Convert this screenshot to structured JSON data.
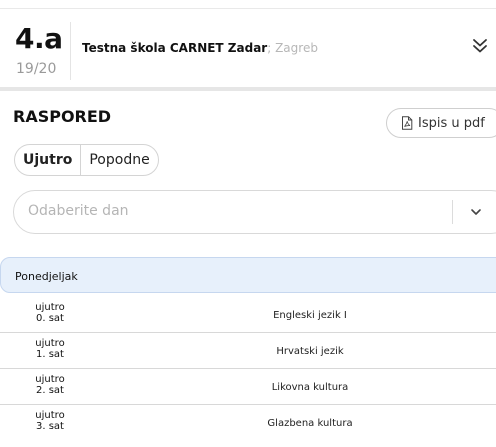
{
  "class": {
    "name": "4.a",
    "school_year": "19/20",
    "school_name": "Testna škola CARNET Zadar",
    "school_sep": ";",
    "city": "Zagreb"
  },
  "schedule": {
    "title": "RASPORED",
    "pdf_button": "Ispis u pdf",
    "shift_tabs": [
      {
        "label": "Ujutro",
        "active": true
      },
      {
        "label": "Popodne",
        "active": false
      }
    ],
    "day_select_placeholder": "Odaberite dan",
    "day": "Ponedjeljak",
    "rows": [
      {
        "shift": "ujutro",
        "period": "0. sat",
        "subject": "Engleski jezik I"
      },
      {
        "shift": "ujutro",
        "period": "1. sat",
        "subject": "Hrvatski jezik"
      },
      {
        "shift": "ujutro",
        "period": "2. sat",
        "subject": "Likovna kultura"
      },
      {
        "shift": "ujutro",
        "period": "3. sat",
        "subject": "Glazbena kultura"
      }
    ]
  },
  "icons": {
    "expand": "double-chevron-down-icon",
    "pdf": "pdf-file-icon",
    "select": "chevron-down-icon"
  }
}
